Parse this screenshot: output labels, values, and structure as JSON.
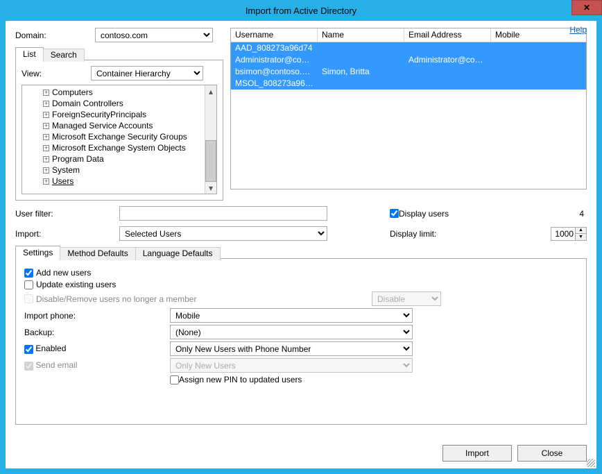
{
  "title": "Import from Active Directory",
  "help": "Help",
  "labels": {
    "domain": "Domain:",
    "view": "View:",
    "user_filter": "User filter:",
    "import": "Import:",
    "display_users": "Display users",
    "display_limit": "Display limit:",
    "import_phone": "Import phone:",
    "backup": "Backup:",
    "enabled": "Enabled",
    "send_email": "Send email",
    "add_new": "Add new users",
    "update_existing": "Update existing users",
    "disable_remove": "Disable/Remove users no longer a member",
    "assign_pin": "Assign new PIN to updated users"
  },
  "domain_value": "contoso.com",
  "tabs": {
    "list": "List",
    "search": "Search"
  },
  "view_value": "Container Hierarchy",
  "tree": [
    "Computers",
    "Domain Controllers",
    "ForeignSecurityPrincipals",
    "Managed Service Accounts",
    "Microsoft Exchange Security Groups",
    "Microsoft Exchange System Objects",
    "Program Data",
    "System",
    "Users"
  ],
  "list_headers": {
    "c1": "Username",
    "c2": "Name",
    "c3": "Email Address",
    "c4": "Mobile"
  },
  "list_rows": [
    {
      "c1": "AAD_808273a96d74",
      "c2": "",
      "c3": "",
      "c4": ""
    },
    {
      "c1": "Administrator@contos...",
      "c2": "",
      "c3": "Administrator@contos...",
      "c4": ""
    },
    {
      "c1": "bsimon@contoso.com",
      "c2": "Simon, Britta",
      "c3": "",
      "c4": ""
    },
    {
      "c1": "MSOL_808273a96d74",
      "c2": "",
      "c3": "",
      "c4": ""
    }
  ],
  "count": "4",
  "display_limit_value": "1000",
  "import_value": "Selected Users",
  "settings_tabs": {
    "t1": "Settings",
    "t2": "Method Defaults",
    "t3": "Language Defaults"
  },
  "disable_action_value": "Disable",
  "import_phone_value": "Mobile",
  "backup_value": "(None)",
  "enabled_value": "Only New Users with Phone Number",
  "send_email_value": "Only New Users",
  "buttons": {
    "import": "Import",
    "close": "Close"
  }
}
